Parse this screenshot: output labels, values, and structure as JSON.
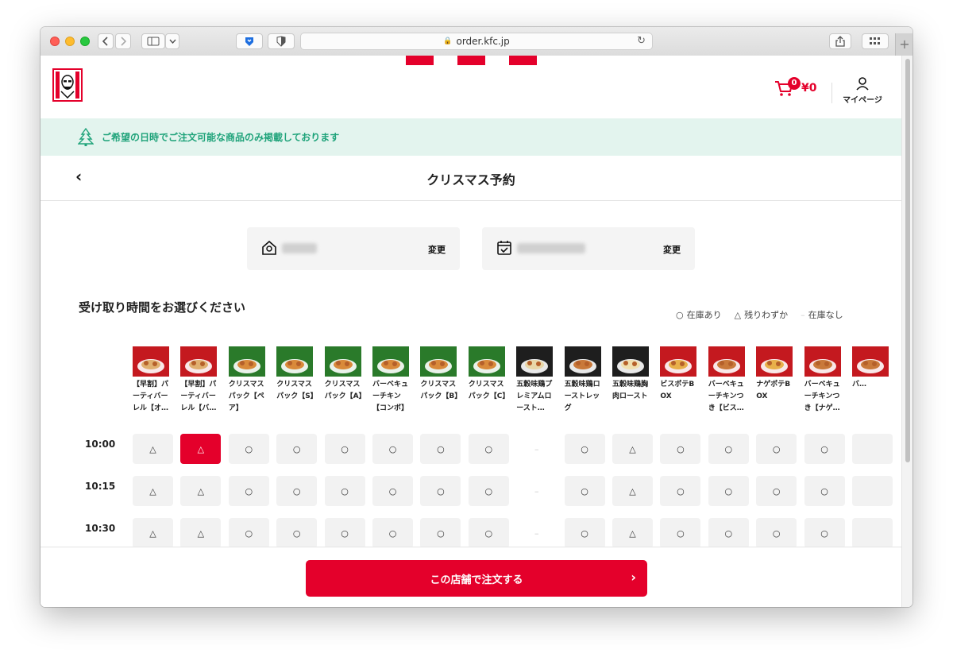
{
  "browser": {
    "url": "order.kfc.jp",
    "new_tab_label": "+"
  },
  "header": {
    "cart_count": "0",
    "cart_total": "¥0",
    "mypage_label": "マイページ"
  },
  "banner": {
    "text": "ご希望の日時でご注文可能な商品のみ掲載しております"
  },
  "titlebar": {
    "back_label": "‹",
    "title": "クリスマス予約"
  },
  "selectors": {
    "store_change": "変更",
    "date_change": "変更"
  },
  "section": {
    "title": "受け取り時間をお選びください"
  },
  "legend": [
    {
      "symbol": "○",
      "label": "在庫あり"
    },
    {
      "symbol": "△",
      "label": "残りわずか"
    },
    {
      "symbol": "–",
      "label": "在庫なし"
    }
  ],
  "products": [
    {
      "name": "【早割】パーティバーレル【オ…",
      "bg": "#c4191f",
      "food": "#e0b070"
    },
    {
      "name": "【早割】パーティバーレル【バ…",
      "bg": "#c4191f",
      "food": "#e0b070"
    },
    {
      "name": "クリスマスパック【ペア】",
      "bg": "#2a7a2a",
      "food": "#d98a3a"
    },
    {
      "name": "クリスマスパック【S】",
      "bg": "#2a7a2a",
      "food": "#d98a3a"
    },
    {
      "name": "クリスマスパック【A】",
      "bg": "#2a7a2a",
      "food": "#d98a3a"
    },
    {
      "name": "バーベキューチキン【コンボ】",
      "bg": "#2a7a2a",
      "food": "#d98a3a"
    },
    {
      "name": "クリスマスパック【B】",
      "bg": "#2a7a2a",
      "food": "#d98a3a"
    },
    {
      "name": "クリスマスパック【C】",
      "bg": "#2a7a2a",
      "food": "#d98a3a"
    },
    {
      "name": "五穀味鶏プレミアムロースト…",
      "bg": "#1e1e1e",
      "food": "#e8d7a8"
    },
    {
      "name": "五穀味鶏ローストレッグ",
      "bg": "#1e1e1e",
      "food": "#c9793a"
    },
    {
      "name": "五穀味鶏胸肉ロースト",
      "bg": "#1e1e1e",
      "food": "#f0e0b0"
    },
    {
      "name": "ビスポテBOX",
      "bg": "#c4191f",
      "food": "#e8b04a"
    },
    {
      "name": "バーベキューチキンつき【ビス…",
      "bg": "#c4191f",
      "food": "#c9793a"
    },
    {
      "name": "ナゲポテBOX",
      "bg": "#c4191f",
      "food": "#e8b04a"
    },
    {
      "name": "バーベキューチキンつき【ナゲ…",
      "bg": "#c4191f",
      "food": "#c9793a"
    },
    {
      "name": "バ…",
      "bg": "#c4191f",
      "food": "#c9793a"
    }
  ],
  "time_slots": [
    {
      "time": "10:00",
      "slots": [
        "△",
        "△",
        "○",
        "○",
        "○",
        "○",
        "○",
        "○",
        "–",
        "○",
        "△",
        "○",
        "○",
        "○",
        "○",
        ""
      ],
      "selected": 1
    },
    {
      "time": "10:15",
      "slots": [
        "△",
        "△",
        "○",
        "○",
        "○",
        "○",
        "○",
        "○",
        "–",
        "○",
        "△",
        "○",
        "○",
        "○",
        "○",
        ""
      ],
      "selected": -1
    },
    {
      "time": "10:30",
      "slots": [
        "△",
        "△",
        "○",
        "○",
        "○",
        "○",
        "○",
        "○",
        "–",
        "○",
        "△",
        "○",
        "○",
        "○",
        "○",
        ""
      ],
      "selected": -1
    }
  ],
  "footer": {
    "order_label": "この店舗で注文する",
    "chevron": "›"
  },
  "colors": {
    "brand_red": "#e4002b",
    "banner_green": "#1fa37a",
    "banner_bg": "#e3f4ee"
  }
}
